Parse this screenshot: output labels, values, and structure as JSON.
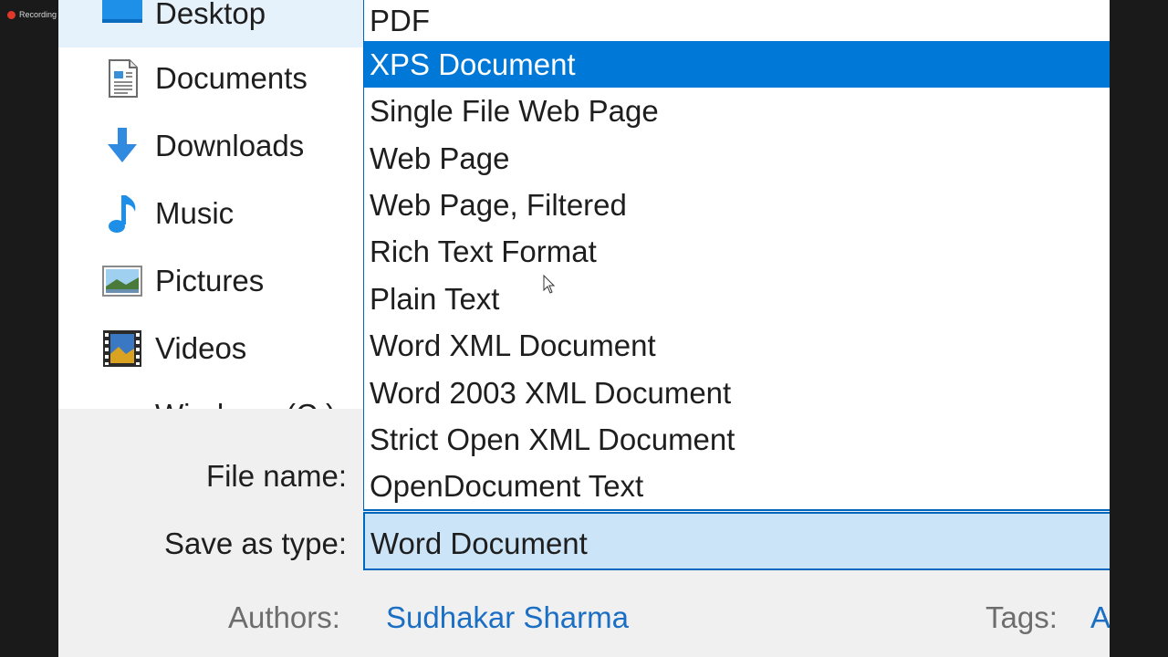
{
  "recording": {
    "label": "Recording"
  },
  "nav": {
    "items": [
      {
        "label": "Desktop",
        "icon": "desktop-icon",
        "selected": true
      },
      {
        "label": "Documents",
        "icon": "documents-icon"
      },
      {
        "label": "Downloads",
        "icon": "downloads-icon"
      },
      {
        "label": "Music",
        "icon": "music-icon"
      },
      {
        "label": "Pictures",
        "icon": "pictures-icon"
      },
      {
        "label": "Videos",
        "icon": "videos-icon"
      },
      {
        "label": "Windows (C:)",
        "icon": "drive-icon"
      }
    ]
  },
  "form": {
    "file_name_label": "File name:",
    "save_as_type_label": "Save as type:",
    "save_as_type_value": "Word Document",
    "authors_label": "Authors:",
    "authors_value": "Sudhakar Sharma",
    "tags_label": "Tags:",
    "tags_value": "Add a tag"
  },
  "dropdown": {
    "options": [
      "PDF",
      "XPS Document",
      "Single File Web Page",
      "Web Page",
      "Web Page, Filtered",
      "Rich Text Format",
      "Plain Text",
      "Word XML Document",
      "Word 2003 XML Document",
      "Strict Open XML Document",
      "OpenDocument Text"
    ],
    "highlighted": "XPS Document"
  },
  "colors": {
    "accent": "#0078d7",
    "select_bg": "#cce4f7",
    "link": "#1a6fc4"
  }
}
